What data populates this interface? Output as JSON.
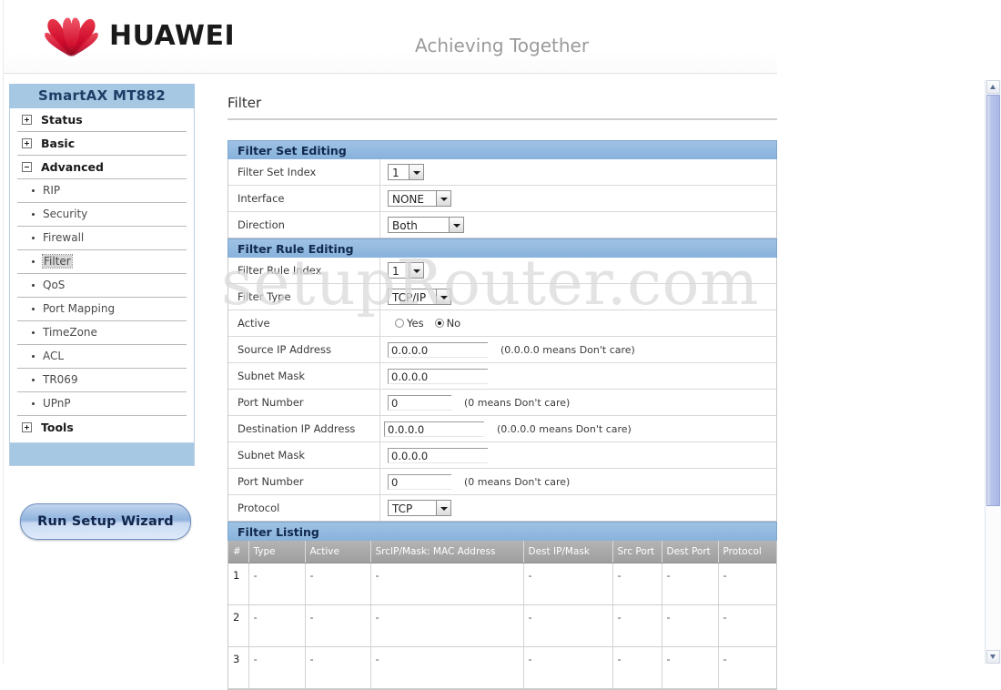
{
  "header": {
    "brand": "HUAWEI",
    "slogan": "Achieving Together",
    "logo_icon": "huawei-flower-logo"
  },
  "sidebar": {
    "title": "SmartAX MT882",
    "groups": [
      {
        "label": "Status",
        "state": "collapsed",
        "icon": "plus-box-icon"
      },
      {
        "label": "Basic",
        "state": "collapsed",
        "icon": "plus-box-icon"
      },
      {
        "label": "Advanced",
        "state": "expanded",
        "icon": "minus-box-icon"
      }
    ],
    "advanced_items": [
      {
        "label": "RIP",
        "selected": false
      },
      {
        "label": "Security",
        "selected": false
      },
      {
        "label": "Firewall",
        "selected": false
      },
      {
        "label": "Filter",
        "selected": true
      },
      {
        "label": "QoS",
        "selected": false
      },
      {
        "label": "Port Mapping",
        "selected": false
      },
      {
        "label": "TimeZone",
        "selected": false
      },
      {
        "label": "ACL",
        "selected": false
      },
      {
        "label": "TR069",
        "selected": false
      },
      {
        "label": "UPnP",
        "selected": false
      }
    ],
    "tools": {
      "label": "Tools",
      "state": "collapsed",
      "icon": "plus-box-icon"
    },
    "wizard_button": "Run Setup Wizard"
  },
  "main": {
    "page_title": "Filter",
    "watermark": "setupRouter.com",
    "filter_set_editing": {
      "heading": "Filter Set Editing",
      "rows": [
        {
          "label": "Filter Set Index",
          "control": "select",
          "value": "1"
        },
        {
          "label": "Interface",
          "control": "select",
          "value": "NONE"
        },
        {
          "label": "Direction",
          "control": "select",
          "value": "Both"
        }
      ]
    },
    "filter_rule_editing": {
      "heading": "Filter Rule Editing",
      "rule_index": {
        "label": "Filter Rule Index",
        "value": "1"
      },
      "filter_type": {
        "label": "Filter Type",
        "value": "TCP/IP"
      },
      "active": {
        "label": "Active",
        "yes_label": "Yes",
        "no_label": "No",
        "selected": "No"
      },
      "source_ip": {
        "label": "Source IP Address",
        "value": "0.0.0.0",
        "hint": "(0.0.0.0 means Don't care)"
      },
      "source_mask": {
        "label": "Subnet Mask",
        "value": "0.0.0.0",
        "hint": ""
      },
      "source_port": {
        "label": "Port Number",
        "value": "0",
        "hint": "(0 means Don't care)"
      },
      "dest_ip": {
        "label": "Destination IP Address",
        "value": "0.0.0.0",
        "hint": "(0.0.0.0 means Don't care)"
      },
      "dest_mask": {
        "label": "Subnet Mask",
        "value": "0.0.0.0",
        "hint": ""
      },
      "dest_port": {
        "label": "Port Number",
        "value": "0",
        "hint": "(0 means Don't care)"
      },
      "protocol": {
        "label": "Protocol",
        "value": "TCP"
      }
    },
    "filter_listing": {
      "heading": "Filter Listing",
      "columns": [
        "#",
        "Type",
        "Active",
        "SrcIP/Mask: MAC Address",
        "Dest IP/Mask",
        "Src Port",
        "Dest Port",
        "Protocol"
      ],
      "rows": [
        {
          "idx": "1",
          "type": "-",
          "active": "-",
          "src": "-",
          "dest": "-",
          "src_port": "-",
          "dest_port": "-",
          "protocol": "-"
        },
        {
          "idx": "2",
          "type": "-",
          "active": "-",
          "src": "-",
          "dest": "-",
          "src_port": "-",
          "dest_port": "-",
          "protocol": "-"
        },
        {
          "idx": "3",
          "type": "-",
          "active": "-",
          "src": "-",
          "dest": "-",
          "src_port": "-",
          "dest_port": "-",
          "protocol": "-"
        }
      ]
    }
  },
  "scrollbar": {
    "up_icon": "chevron-up-icon",
    "down_icon": "chevron-down-icon"
  },
  "colors": {
    "brand_red": "#cf0a2c",
    "sidebar_header": "#a7c8e3",
    "section_header": "#8fb6de",
    "table_header": "#a4a4a4"
  }
}
